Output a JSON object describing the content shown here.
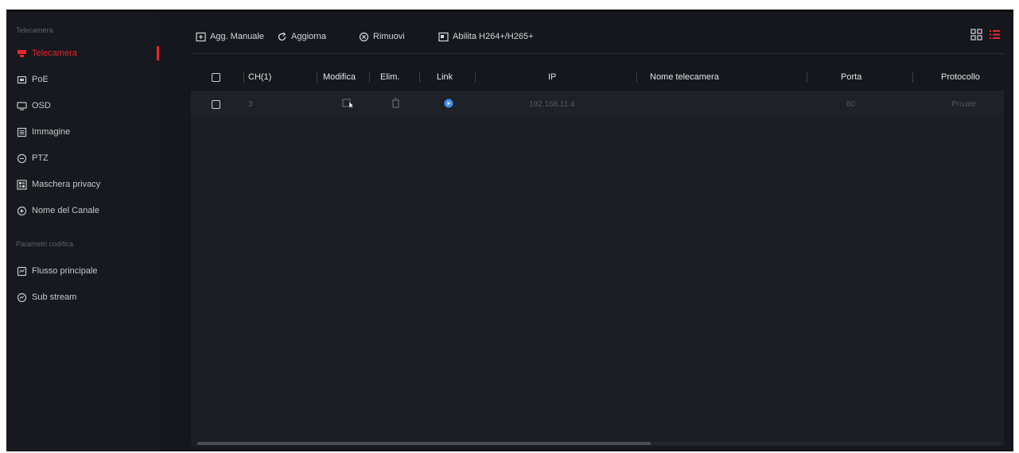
{
  "sidebar": {
    "section_camera": "Telecamera",
    "section_encoding": "Parametri codifica",
    "items": [
      {
        "label": "Telecamera",
        "icon": "camera-icon",
        "active": true
      },
      {
        "label": "PoE",
        "icon": "poe-icon"
      },
      {
        "label": "OSD",
        "icon": "monitor-icon"
      },
      {
        "label": "Immagine",
        "icon": "image-settings-icon"
      },
      {
        "label": "PTZ",
        "icon": "ptz-icon"
      },
      {
        "label": "Maschera privacy",
        "icon": "privacy-mask-icon"
      },
      {
        "label": "Nome del Canale",
        "icon": "channel-name-icon"
      },
      {
        "label": "Flusso principale",
        "icon": "main-stream-icon"
      },
      {
        "label": "Sub stream",
        "icon": "sub-stream-icon"
      }
    ]
  },
  "toolbar": {
    "add_manual": "Agg. Manuale",
    "refresh": "Aggiorna",
    "remove": "Rimuovi",
    "enable_codec": "Abilita H264+/H265+"
  },
  "table": {
    "headers": {
      "ch": "CH(1)",
      "edit": "Modifica",
      "delete": "Elim.",
      "link": "Link",
      "ip": "IP",
      "name": "Nome telecamera",
      "port": "Porta",
      "protocol": "Protocollo"
    },
    "rows": [
      {
        "ch": "3",
        "ip": "192.168.11.4",
        "name": "",
        "port": "80",
        "protocol": "Private",
        "link_status": "connected"
      }
    ]
  },
  "colors": {
    "accent": "#e8262c",
    "link": "#3b8ef0",
    "view_list": "#e8262c"
  }
}
